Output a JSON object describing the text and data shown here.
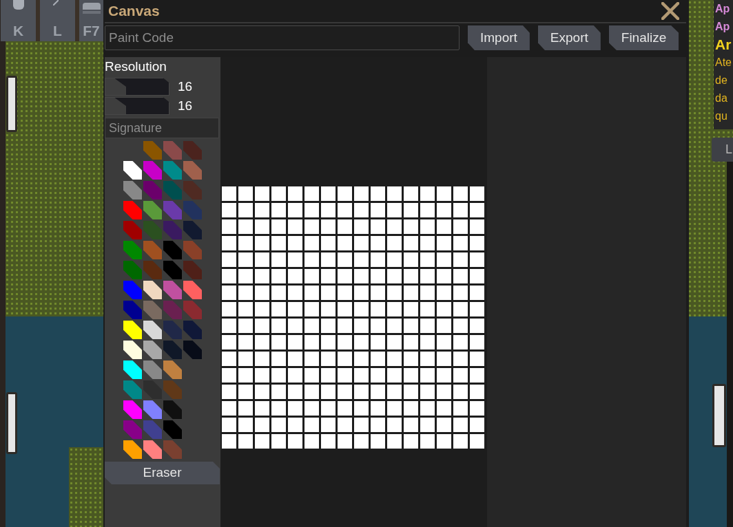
{
  "hud_keys": [
    {
      "label": "K"
    },
    {
      "label": "L"
    },
    {
      "label": "F7"
    }
  ],
  "window": {
    "title": "Canvas"
  },
  "toolbar": {
    "paint_code": {
      "placeholder": "Paint Code"
    },
    "buttons": [
      "Import",
      "Export",
      "Finalize"
    ]
  },
  "resolution": {
    "label": "Resolution",
    "sliders": [
      {
        "level": 0,
        "value": "16"
      },
      {
        "level": 0,
        "value": "16"
      }
    ]
  },
  "signature": {
    "placeholder": "Signature"
  },
  "palette": [
    [
      {
        "kind": "blank"
      },
      {
        "kind": "swatch",
        "color": "#8a5500"
      },
      {
        "kind": "swatch",
        "color": "#8b4a4a"
      },
      {
        "kind": "swatch",
        "color": "#4b231e"
      }
    ],
    [
      {
        "kind": "swatch",
        "color": "#ffffff"
      },
      {
        "kind": "swatch",
        "color": "#c800c8"
      },
      {
        "kind": "swatch",
        "color": "#008b8b"
      },
      {
        "kind": "swatch",
        "color": "#a0604c"
      }
    ],
    [
      {
        "kind": "swatch",
        "color": "#888888"
      },
      {
        "kind": "swatch",
        "color": "#6b006b"
      },
      {
        "kind": "swatch",
        "color": "#004f4f"
      },
      {
        "kind": "swatch",
        "color": "#4f2a22"
      }
    ],
    [
      {
        "kind": "swatch",
        "color": "#ff0000"
      },
      {
        "kind": "swatch",
        "color": "#5a9a3a"
      },
      {
        "kind": "swatch",
        "color": "#6a3aaa"
      },
      {
        "kind": "swatch",
        "color": "#22325e"
      }
    ],
    [
      {
        "kind": "swatch",
        "color": "#a00000"
      },
      {
        "kind": "swatch",
        "color": "#2b5020"
      },
      {
        "kind": "swatch",
        "color": "#3a1a60"
      },
      {
        "kind": "swatch",
        "color": "#121a30"
      }
    ],
    [
      {
        "kind": "swatch",
        "color": "#008800"
      },
      {
        "kind": "swatch",
        "color": "#a05020"
      },
      {
        "kind": "swatch",
        "color": "#000000"
      },
      {
        "kind": "swatch",
        "color": "#8a4028"
      }
    ],
    [
      {
        "kind": "swatch",
        "color": "#006800"
      },
      {
        "kind": "swatch",
        "color": "#5a2a10"
      },
      {
        "kind": "swatch",
        "color": "#000000"
      },
      {
        "kind": "swatch",
        "color": "#4f2018"
      }
    ],
    [
      {
        "kind": "swatch",
        "color": "#0000ff"
      },
      {
        "kind": "swatch",
        "color": "#f0d8c0"
      },
      {
        "kind": "swatch",
        "color": "#c050a0"
      },
      {
        "kind": "swatch",
        "color": "#ff6060"
      }
    ],
    [
      {
        "kind": "swatch",
        "color": "#000090"
      },
      {
        "kind": "swatch",
        "color": "#7a6a60"
      },
      {
        "kind": "swatch",
        "color": "#6a2050"
      },
      {
        "kind": "swatch",
        "color": "#8b2a30"
      }
    ],
    [
      {
        "kind": "swatch",
        "color": "#ffff00"
      },
      {
        "kind": "swatch",
        "color": "#d8d8d8"
      },
      {
        "kind": "swatch",
        "color": "#202848"
      },
      {
        "kind": "swatch",
        "color": "#101838"
      }
    ],
    [
      {
        "kind": "swatch",
        "color": "#fffde0"
      },
      {
        "kind": "swatch",
        "color": "#a8a8a8"
      },
      {
        "kind": "swatch",
        "color": "#101828"
      },
      {
        "kind": "swatch",
        "color": "#080c18"
      }
    ],
    [
      {
        "kind": "swatch",
        "color": "#00ffff"
      },
      {
        "kind": "swatch",
        "color": "#888888"
      },
      {
        "kind": "swatch",
        "color": "#c08040"
      },
      {
        "kind": "blank"
      }
    ],
    [
      {
        "kind": "swatch",
        "color": "#008888"
      },
      {
        "kind": "swatch",
        "color": "#2e2e2e"
      },
      {
        "kind": "swatch",
        "color": "#603818"
      },
      {
        "kind": "blank"
      }
    ],
    [
      {
        "kind": "swatch",
        "color": "#ff00ff"
      },
      {
        "kind": "swatch",
        "color": "#8080ff"
      },
      {
        "kind": "swatch",
        "color": "#101010"
      },
      {
        "kind": "blank"
      }
    ],
    [
      {
        "kind": "swatch",
        "color": "#880088"
      },
      {
        "kind": "swatch",
        "color": "#404090"
      },
      {
        "kind": "swatch",
        "color": "#000000"
      },
      {
        "kind": "blank"
      }
    ],
    [
      {
        "kind": "swatch",
        "color": "#ffa000"
      },
      {
        "kind": "swatch",
        "color": "#ff8080"
      },
      {
        "kind": "swatch",
        "color": "#7a4030"
      },
      {
        "kind": "blank"
      }
    ]
  ],
  "eraser": {
    "label": "Eraser"
  },
  "side_panel": {
    "lines": [
      {
        "kind": "entry",
        "text": "Ap"
      },
      {
        "kind": "entry",
        "text": "Ap"
      },
      {
        "kind": "heading",
        "text": "Ar"
      },
      {
        "kind": "body",
        "text": "Ate"
      },
      {
        "kind": "body",
        "text": "de"
      },
      {
        "kind": "body",
        "text": "da"
      },
      {
        "kind": "body",
        "text": "qu"
      }
    ]
  },
  "side_button": {
    "label": "L"
  }
}
